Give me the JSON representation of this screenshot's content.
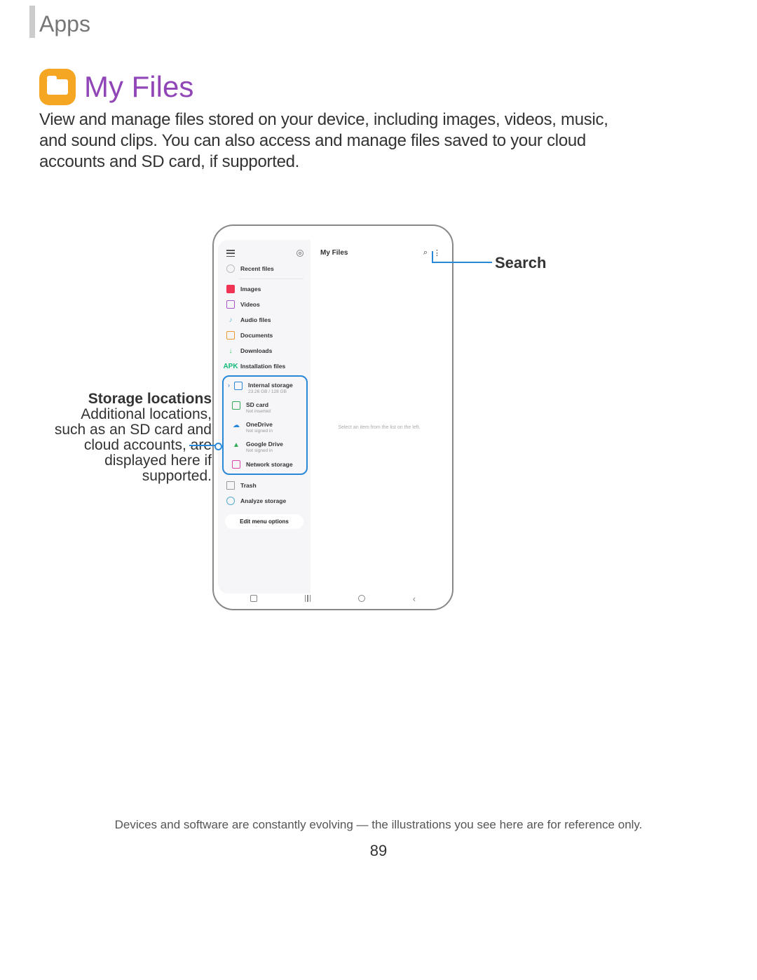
{
  "header": {
    "section": "Apps"
  },
  "title": "My Files",
  "description": "View and manage files stored on your device, including images, videos, music, and sound clips. You can also access and manage files saved to your cloud accounts and SD card, if supported.",
  "callouts": {
    "search": "Search",
    "storage_head": "Storage locations",
    "storage_body": "Additional locations, such as an SD card and cloud accounts, are displayed here if supported."
  },
  "device": {
    "main_title": "My Files",
    "empty_hint": "Select an item from the list on the left.",
    "edit_menu": "Edit menu options",
    "sidebar": {
      "recent": "Recent files",
      "images": "Images",
      "videos": "Videos",
      "audio": "Audio files",
      "documents": "Documents",
      "downloads": "Downloads",
      "installation": "Installation files",
      "trash": "Trash",
      "analyze": "Analyze storage"
    },
    "storage": {
      "internal": {
        "label": "Internal storage",
        "sub": "23.26 GB / 128 GB"
      },
      "sd": {
        "label": "SD card",
        "sub": "Not inserted"
      },
      "onedrive": {
        "label": "OneDrive",
        "sub": "Not signed in"
      },
      "gdrive": {
        "label": "Google Drive",
        "sub": "Not signed in"
      },
      "network": {
        "label": "Network storage"
      }
    }
  },
  "footer": {
    "note": "Devices and software are constantly evolving — the illustrations you see here are for reference only.",
    "page": "89"
  }
}
